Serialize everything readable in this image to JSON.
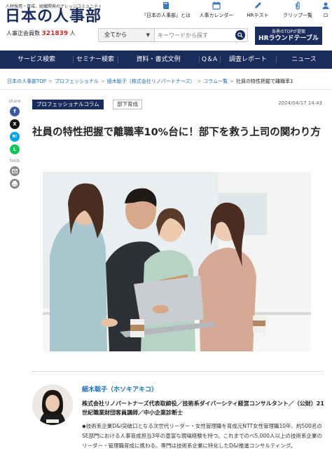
{
  "header": {
    "tagline": "人材採用・育成、組織開発のナレッジコミュニティ",
    "logo": "日本の人事部",
    "members_prefix": "人事正会員数",
    "members_count": "321839",
    "members_suffix": "人",
    "top_links": [
      {
        "label": "『日本の人事部』とは",
        "icon": "book-icon"
      },
      {
        "label": "人事カレンダー",
        "icon": "calendar-icon"
      },
      {
        "label": "HRテスト",
        "icon": "pencil-icon"
      },
      {
        "label": "クリップ一覧",
        "icon": "clip-icon"
      },
      {
        "label": "ロ",
        "icon": "login-icon"
      }
    ],
    "search": {
      "select_value": "全てから",
      "placeholder": "キーワードから探す"
    },
    "promo": {
      "line1": "各界のTOPが提案",
      "line2": "HRラウンドテーブル"
    }
  },
  "nav": {
    "items": [
      "サービス検索",
      "セミナー検索",
      "資料・書式文例",
      "Q＆A",
      "調査レポート",
      "ニュース"
    ]
  },
  "breadcrumb": {
    "items": [
      "日本の人事部TOP",
      "プロフェッショナル",
      "細木聡子（株式会社リノパートナーズ）",
      "コラム一覧"
    ],
    "current": "社員の特性把握で離職率1"
  },
  "share": {
    "share_label": "share",
    "tools_label": "tools",
    "buttons": [
      {
        "name": "facebook",
        "glyph": "f"
      },
      {
        "name": "x",
        "glyph": "X"
      },
      {
        "name": "hatena",
        "glyph": "B!"
      },
      {
        "name": "line",
        "glyph": "L"
      }
    ]
  },
  "article": {
    "category": "プロフェッショナルコラム",
    "tag": "部下育成",
    "date": "2024/04/17 14:43",
    "title": "社員の特性把握で離職率10%台に！部下を救う上司の関わり方"
  },
  "author": {
    "name": "細木聡子（ホソキアキコ）",
    "affiliation": "株式会社リノパートナーズ代表取締役／技術系ダイバーシティ経営コンサルタント／（公財）21世紀職業財団客員講師／中小企業診断士",
    "bio": "◆技術系企業D&I突破口となる次世代リーダー・女性管理職を育成元NTT女性管理職10年、約500名のSE部門における人事育成担当3年の豊富な現場経験を持つ。これまでのべ5,000人以上の技術系企業のリーダー・管理職育成に携わる。専門は技術系企業に特化したD&I推進コンサルティング。"
  },
  "colors": {
    "navy": "#1a2c5c",
    "link": "#1a6fb5",
    "count_red": "#d12c2c"
  }
}
